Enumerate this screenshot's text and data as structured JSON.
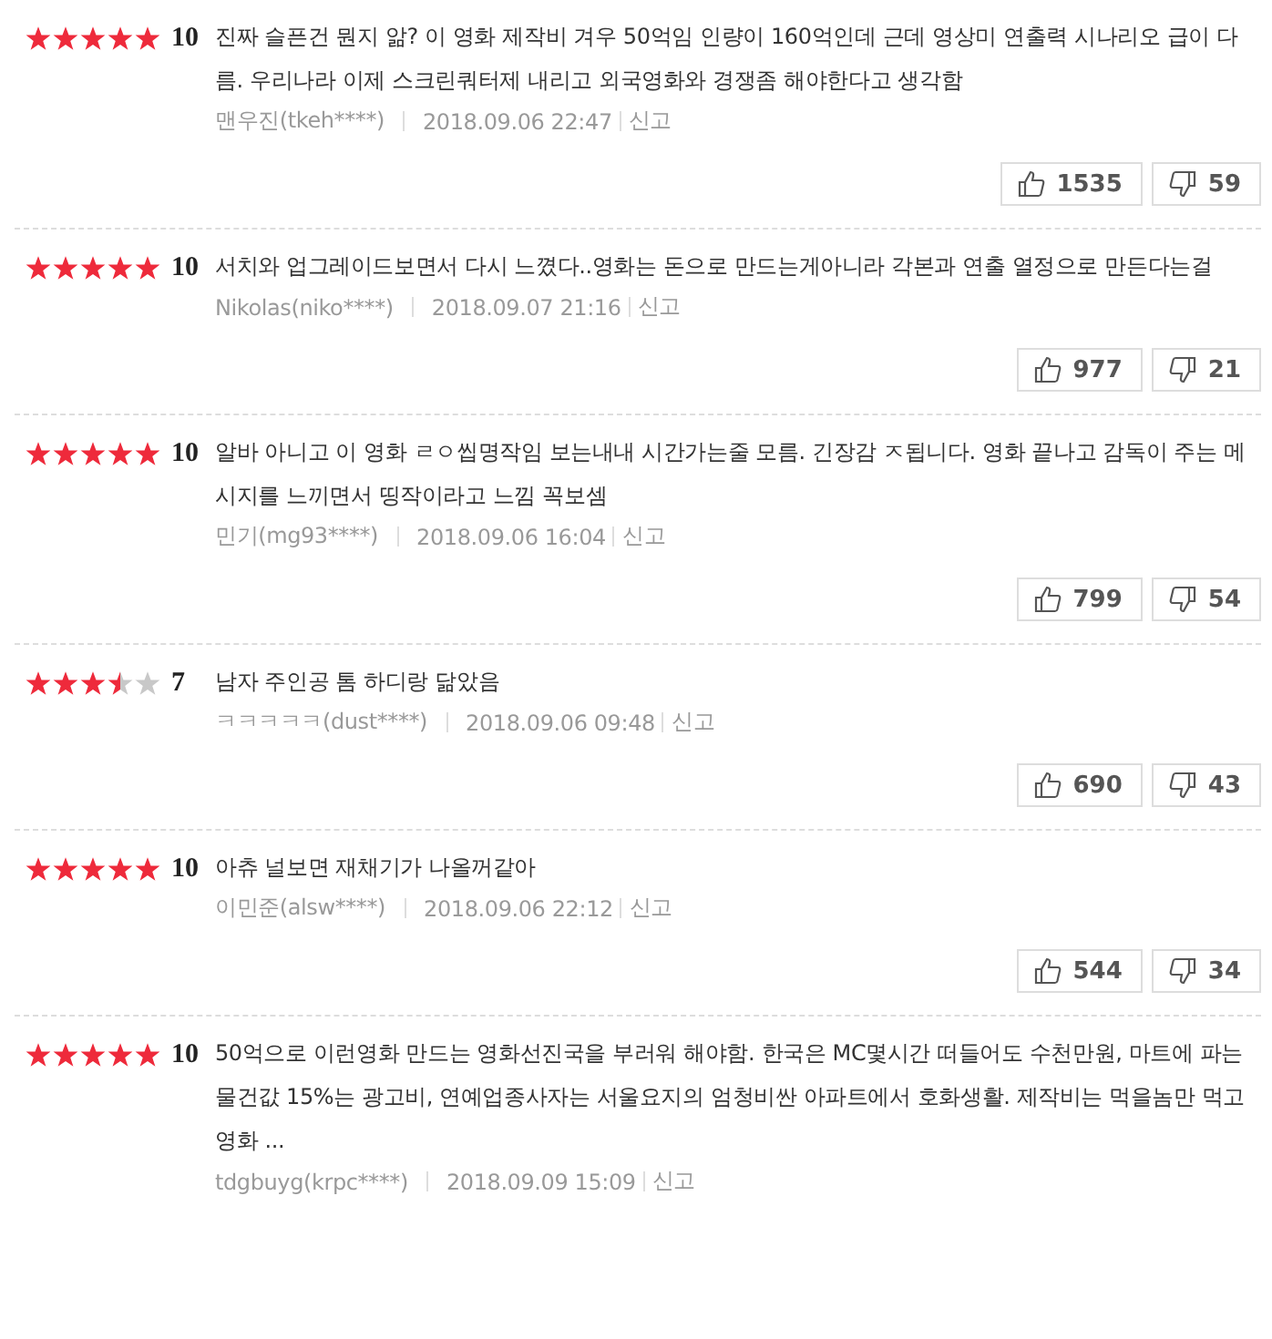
{
  "reviews": [
    {
      "stars": 5,
      "score": "10",
      "text": "진짜 슬픈건 뭔지 앎? 이 영화 제작비 겨우 50억임 인량이 160억인데 근데 영상미 연출력 시나리오 급이 다름. 우리나라 이제 스크린쿼터제 내리고 외국영화와 경쟁좀 해야한다고 생각함",
      "author": "맨우진(tkeh****)",
      "date": "2018.09.06 22:47",
      "report": "신고",
      "likes": "1535",
      "dislikes": "59"
    },
    {
      "stars": 5,
      "score": "10",
      "text": "서치와 업그레이드보면서 다시 느꼈다..영화는 돈으로 만드는게아니라 각본과 연출 열정으로 만든다는걸",
      "author": "Nikolas(niko****)",
      "date": "2018.09.07 21:16",
      "report": "신고",
      "likes": "977",
      "dislikes": "21"
    },
    {
      "stars": 5,
      "score": "10",
      "text": "알바 아니고 이 영화 ㄹㅇ씹명작임 보는내내 시간가는줄 모름. 긴장감 ㅈ됩니다. 영화 끝나고 감독이 주는 메시지를 느끼면서 띵작이라고 느낌 꼭보셈",
      "author": "민기(mg93****)",
      "date": "2018.09.06 16:04",
      "report": "신고",
      "likes": "799",
      "dislikes": "54"
    },
    {
      "stars": 3.5,
      "score": "7",
      "text": "남자 주인공 톰 하디랑 닮았음",
      "author": "ㅋㅋㅋㅋㅋ(dust****)",
      "date": "2018.09.06 09:48",
      "report": "신고",
      "likes": "690",
      "dislikes": "43"
    },
    {
      "stars": 5,
      "score": "10",
      "text": "아츄 널보면 재채기가 나올꺼같아",
      "author": "이민준(alsw****)",
      "date": "2018.09.06 22:12",
      "report": "신고",
      "likes": "544",
      "dislikes": "34"
    },
    {
      "stars": 5,
      "score": "10",
      "text": "50억으로 이런영화 만드는 영화선진국을 부러워 해야함. 한국은 MC몇시간 떠들어도 수천만원, 마트에 파는 물건값 15%는 광고비, 연예업종사자는 서울요지의 엄청비싼 아파트에서 호화생활. 제작비는 먹을놈만 먹고 영화 ...",
      "author": "tdgbuyg(krpc****)",
      "date": "2018.09.09 15:09",
      "report": "신고"
    }
  ]
}
